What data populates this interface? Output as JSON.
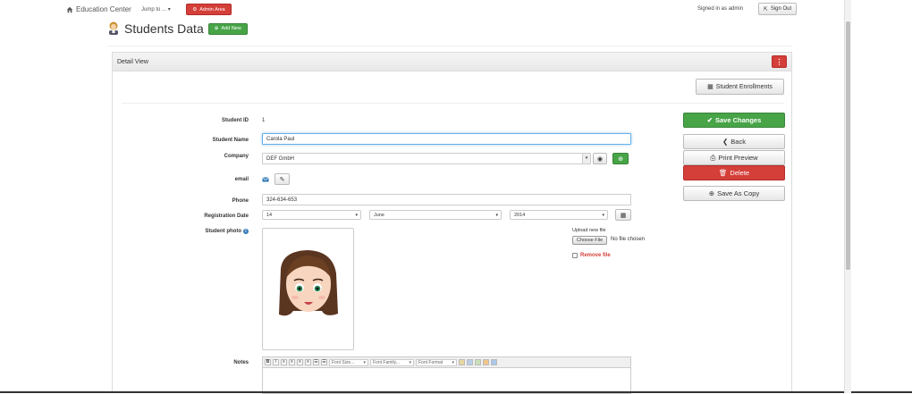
{
  "navbar": {
    "brand": "Education Center",
    "jump_to": "Jump to ...",
    "admin_area": "Admin Area",
    "signed_in": "Signed in as admin",
    "sign_out": "Sign Out"
  },
  "page": {
    "title": "Students Data",
    "add_new": "Add New"
  },
  "panel": {
    "title": "Detail View",
    "student_enrollments": "Student Enrollments"
  },
  "form": {
    "student_id_label": "Student ID",
    "student_id_value": "1",
    "student_name_label": "Student Name",
    "student_name_value": "Carola Paul",
    "company_label": "Company",
    "company_value": "DEF GmbH",
    "email_label": "email",
    "phone_label": "Phone",
    "phone_value": "324-634-653",
    "registration_date_label": "Registration Date",
    "reg_day": "14",
    "reg_month": "June",
    "reg_year": "2014",
    "student_photo_label": "Student photo",
    "upload_new_file": "Upload new file",
    "choose_file": "Choose File",
    "no_file_chosen": "No file chosen",
    "remove_file": "Remove file",
    "notes_label": "Notes"
  },
  "editor": {
    "font_size": "Font Size...",
    "font_family": "Font Family...",
    "font_format": "Font Format"
  },
  "actions": {
    "save_changes": "Save Changes",
    "back": "Back",
    "print_preview": "Print Preview",
    "delete": "Delete",
    "save_as_copy": "Save As Copy"
  },
  "colors": {
    "success": "#47a447",
    "danger": "#d43f3a",
    "info": "#337ab7"
  }
}
